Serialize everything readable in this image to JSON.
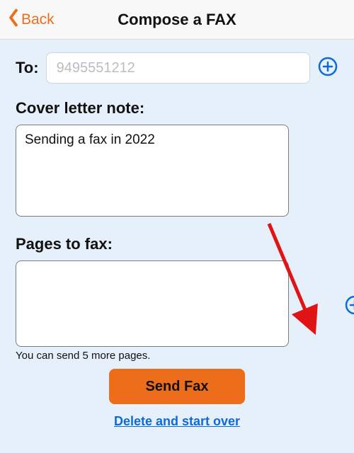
{
  "nav": {
    "back_label": "Back",
    "title": "Compose a FAX"
  },
  "to": {
    "label": "To:",
    "placeholder": "9495551212",
    "value": ""
  },
  "cover_note": {
    "label": "Cover letter note:",
    "value": "Sending a fax in 2022"
  },
  "pages": {
    "label": "Pages to fax:",
    "remaining_text": "You can send 5 more pages."
  },
  "actions": {
    "send_label": "Send Fax",
    "delete_label": "Delete and start over"
  },
  "colors": {
    "accent_orange": "#ec6e1a",
    "link_blue": "#0a6adf",
    "icon_blue": "#0a6adf",
    "bg": "#e6f0fa"
  }
}
